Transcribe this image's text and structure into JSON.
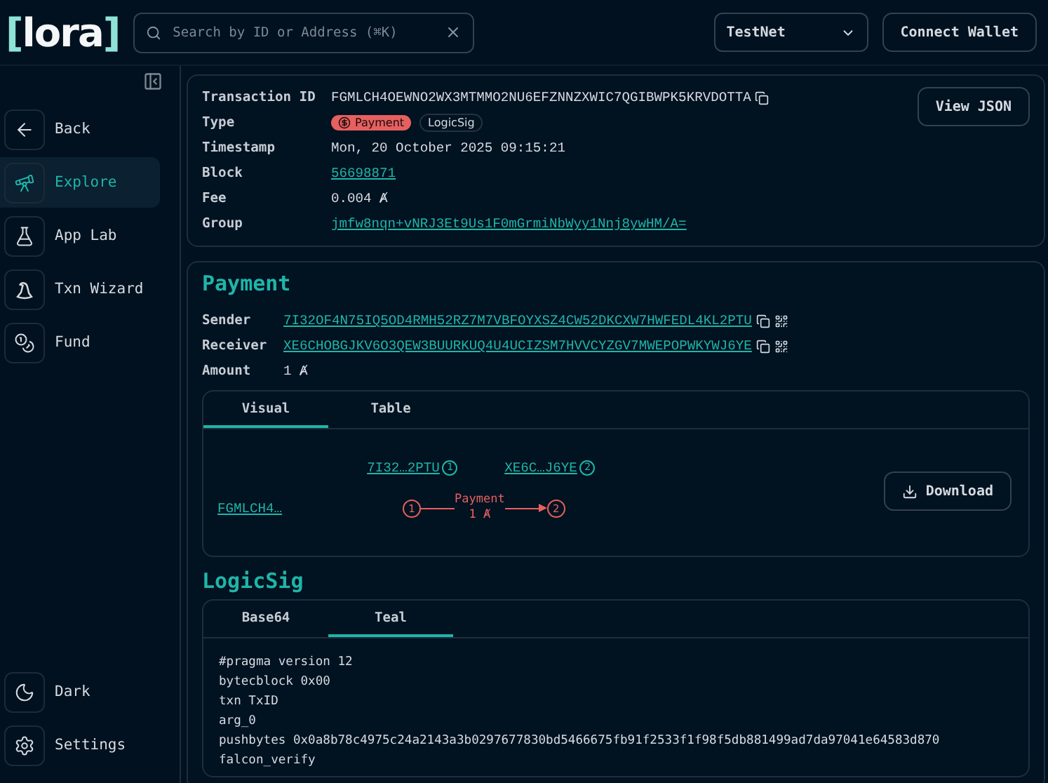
{
  "header": {
    "logo": {
      "open": "[",
      "name": "lora",
      "close": "]"
    },
    "search": {
      "placeholder": "Search by ID or Address (⌘K)"
    },
    "network": "TestNet",
    "connect": "Connect Wallet"
  },
  "sidebar": {
    "items": [
      {
        "label": "Back",
        "kind": "back",
        "selected": false
      },
      {
        "label": "Explore",
        "kind": "explore",
        "selected": true
      },
      {
        "label": "App Lab",
        "kind": "lab",
        "selected": false
      },
      {
        "label": "Txn Wizard",
        "kind": "wizard",
        "selected": false
      },
      {
        "label": "Fund",
        "kind": "fund",
        "selected": false
      }
    ],
    "bottom": [
      {
        "label": "Dark",
        "kind": "theme"
      },
      {
        "label": "Settings",
        "kind": "settings"
      }
    ]
  },
  "transaction": {
    "fields": [
      {
        "label": "Transaction ID",
        "kind": "copy",
        "value": "FGMLCH4OEWNO2WX3MTMMO2NU6EFZNNZXWIC7QGIBWPK5KRVDOTTA"
      },
      {
        "label": "Type",
        "kind": "badges",
        "badges": [
          {
            "label": "Payment",
            "kind": "payment"
          },
          {
            "label": "LogicSig",
            "kind": "plain"
          }
        ]
      },
      {
        "label": "Timestamp",
        "kind": "text",
        "value": "Mon, 20 October 2025 09:15:21"
      },
      {
        "label": "Block",
        "kind": "link",
        "value": "56698871"
      },
      {
        "label": "Fee",
        "kind": "text",
        "value": "0.004 Ⱥ"
      },
      {
        "label": "Group",
        "kind": "link",
        "value": "jmfw8nqn+vNRJ3Et9Us1F0mGrmiNbWyy1Nnj8ywHM/A="
      }
    ],
    "view_json": "View JSON"
  },
  "payment": {
    "title": "Payment",
    "fields": [
      {
        "label": "Sender",
        "kind": "address",
        "value": "7I32OF4N75IQ5OD4RMH52RZ7M7VBFOYXSZ4CW52DKCXW7HWFEDL4KL2PTU"
      },
      {
        "label": "Receiver",
        "kind": "address",
        "value": "XE6CHOBGJKV6O3QEW3BUURKUQ4U4UCIZSM7HVVCYZGV7MWEPOPWKYWJ6YE"
      },
      {
        "label": "Amount",
        "kind": "text",
        "value": "1 Ⱥ"
      }
    ],
    "tabs": [
      {
        "label": "Visual",
        "selected": true
      },
      {
        "label": "Table",
        "selected": false
      }
    ],
    "graph": {
      "transaction": "FGMLCH4…",
      "accounts": [
        {
          "label": "7I32…2PTU",
          "number": "1"
        },
        {
          "label": "XE6C…J6YE",
          "number": "2"
        }
      ],
      "arrow_label": "Payment",
      "arrow_amount": "1 Ⱥ",
      "nodes": [
        "1",
        "2"
      ]
    },
    "download": "Download"
  },
  "logicsig": {
    "title": "LogicSig",
    "tabs": [
      {
        "label": "Base64",
        "selected": false
      },
      {
        "label": "Teal",
        "selected": true
      }
    ],
    "code": [
      "#pragma version 12",
      "bytecblock 0x00",
      "txn TxID",
      "arg_0",
      "pushbytes 0x0a8b78c4975c24a2143a3b0297677830bd5466675fb91f2533f1f98f5db881499ad7da97041e64583d870",
      "falcon_verify"
    ]
  }
}
